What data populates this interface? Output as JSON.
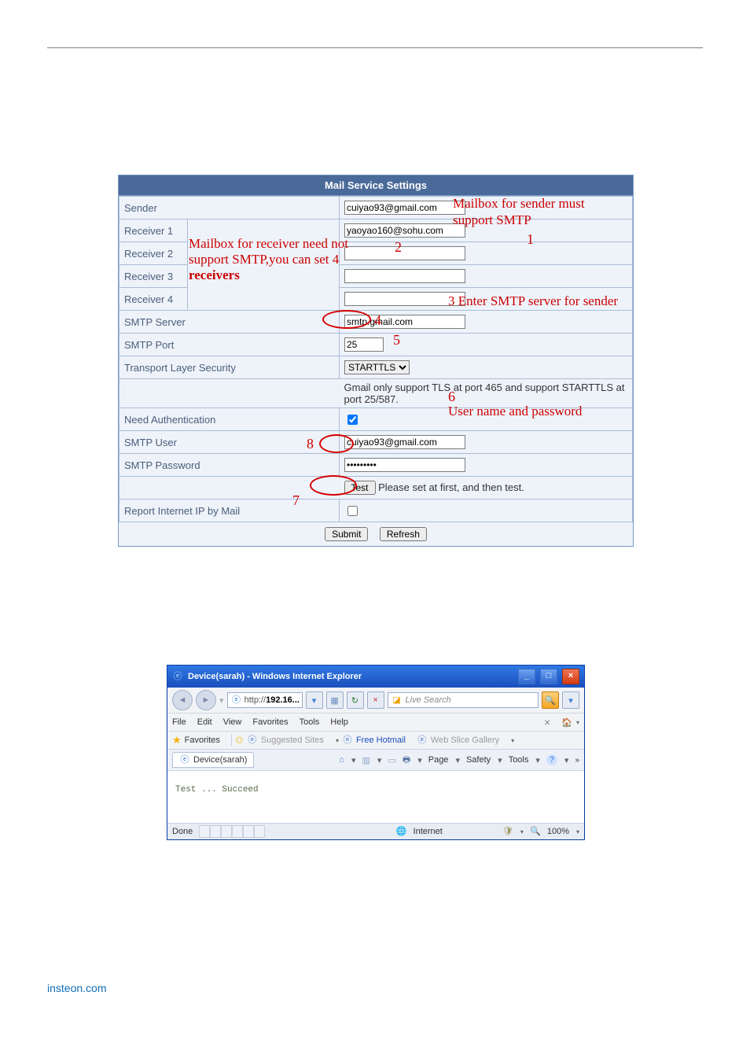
{
  "mail": {
    "banner": "Mail Service Settings",
    "rows": {
      "sender_lbl": "Sender",
      "sender_val": "cuiyao93@gmail.com",
      "recv1_lbl": "Receiver 1",
      "recv1_val": "yaoyao160@sohu.com",
      "recv2_lbl": "Receiver 2",
      "recv2_val": "",
      "recv3_lbl": "Receiver 3",
      "recv3_val": "",
      "recv4_lbl": "Receiver 4",
      "recv4_val": "",
      "smtp_server_lbl": "SMTP Server",
      "smtp_server_val": "smtp.gmail.com",
      "smtp_port_lbl": "SMTP Port",
      "smtp_port_val": "25",
      "tls_lbl": "Transport Layer Security",
      "tls_val": "STARTTLS",
      "tls_note": "Gmail only support TLS at port 465 and support STARTTLS at port 25/587.",
      "need_auth_lbl": "Need Authentication",
      "need_auth_checked": true,
      "smtp_user_lbl": "SMTP User",
      "smtp_user_val": "cuiyao93@gmail.com",
      "smtp_pass_lbl": "SMTP Password",
      "smtp_pass_val": "•••••••••",
      "test_btn": "Test",
      "test_hint": "Please set at first, and then test.",
      "report_ip_lbl": "Report Internet IP by Mail",
      "report_ip_checked": false,
      "submit_btn": "Submit",
      "refresh_btn": "Refresh"
    },
    "callouts": {
      "c1": "Mailbox for sender must support SMTP",
      "n1": "1",
      "c2a": "Mailbox for receiver need not",
      "c2b": "support SMTP,you can set 4",
      "c2c": "receivers",
      "n2": "2",
      "c3": "3 Enter SMTP server for sender",
      "n4": "4",
      "n5": "5",
      "c6a": "6",
      "c6b": "User name and password",
      "n7": "7",
      "n8": "8"
    }
  },
  "ie": {
    "title": "Device(sarah) - Windows Internet Explorer",
    "url_prefix": "http://",
    "url_bold": "192.16...",
    "search_placeholder": "Live Search",
    "menus": [
      "File",
      "Edit",
      "View",
      "Favorites",
      "Tools",
      "Help"
    ],
    "x_home_close": "×",
    "fav_label": "Favorites",
    "suggested": "Suggested Sites",
    "freehotmail": "Free Hotmail",
    "webslice": "Web Slice Gallery",
    "tab_label": "Device(sarah)",
    "cmd_page": "Page",
    "cmd_safety": "Safety",
    "cmd_tools": "Tools",
    "body_text": "Test  ... Succeed",
    "status_done": "Done",
    "status_zone": "Internet",
    "status_zoom": "100%"
  },
  "footer": "insteon.com"
}
